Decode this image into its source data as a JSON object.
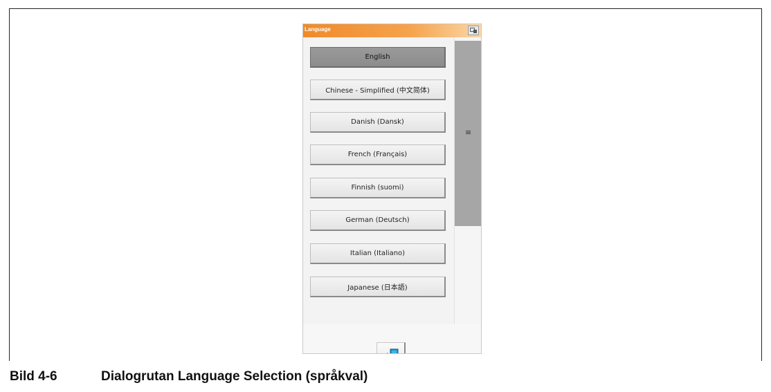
{
  "dialog": {
    "title": "Language",
    "languages": [
      {
        "label": "English",
        "selected": true
      },
      {
        "label": "Chinese - Simplified (中文简体)",
        "selected": false
      },
      {
        "label": "Danish (Dansk)",
        "selected": false
      },
      {
        "label": "French (Français)",
        "selected": false
      },
      {
        "label": "Finnish (suomi)",
        "selected": false
      },
      {
        "label": "German (Deutsch)",
        "selected": false
      },
      {
        "label": "Italian (Italiano)",
        "selected": false
      },
      {
        "label": "Japanese (日本語)",
        "selected": false
      }
    ],
    "scroll_grip": "≡",
    "exit_icon": "exit-door-icon",
    "accent_color": "#f08a2a"
  },
  "caption": {
    "number": "Bild 4-6",
    "text": "Dialogrutan Language Selection (språkval)"
  }
}
